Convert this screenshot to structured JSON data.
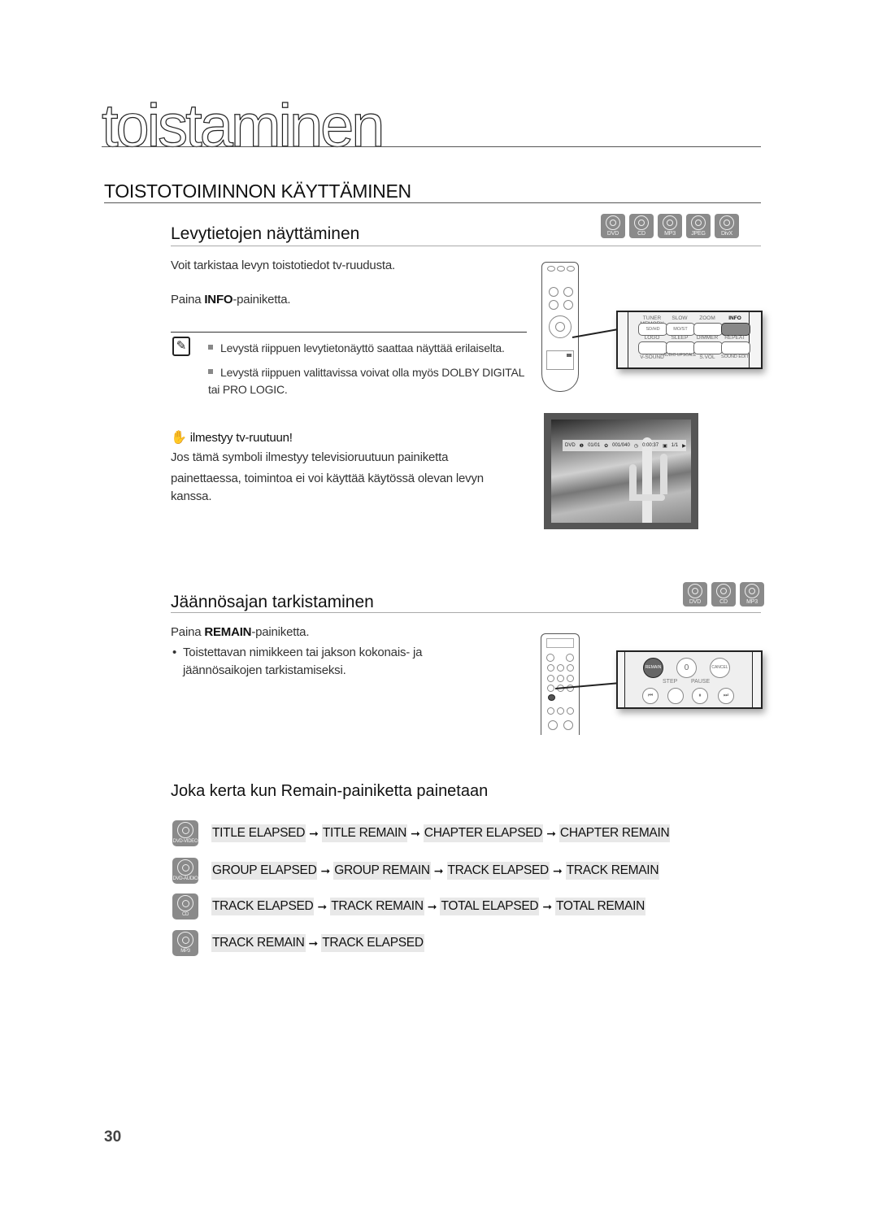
{
  "chapter_title": "toistaminen",
  "section_title": "TOISTOTOIMINNON KÄYTTÄMINEN",
  "disc_info": {
    "title": "Levytietojen näyttäminen",
    "disc_badges": [
      "DVD",
      "CD",
      "MP3",
      "JPEG",
      "DivX"
    ],
    "intro": "Voit tarkistaa levyn toistotiedot tv-ruudusta.",
    "press_prefix": "Paina ",
    "press_button": "INFO",
    "press_suffix": "-painiketta.",
    "notes": [
      "Levystä riippuen levytietonäyttö saattaa näyttää erilaiselta.",
      "Levystä riippuen valittavissa voivat olla myös DOLBY DIGITAL tai PRO LOGIC."
    ],
    "hand_heading": "ilmestyy tv-ruutuun!",
    "hand_text_1": "Jos tämä symboli ilmestyy televisioruutuun painiketta",
    "hand_text_2": "painettaessa, toimintoa ei voi käyttää käytössä olevan levyn kanssa.",
    "remote_callout": {
      "row1_labels": [
        "TUNER MEMORY",
        "SLOW",
        "ZOOM",
        "INFO"
      ],
      "row1_buttons": [
        "SD/HD",
        "MO/ST",
        "",
        ""
      ],
      "row2_labels": [
        "LOGO",
        "SLEEP",
        "DIMMER",
        "REPEAT"
      ],
      "row3_labels": [
        "V-SOUND",
        "AUDIO UPSCALE",
        "S.VOL",
        "SOUND EDIT"
      ]
    },
    "tv_osd": {
      "disc": "DVD",
      "title": "01/01",
      "chapter": "001/040",
      "time": "0:00:37",
      "angle": "1/1"
    }
  },
  "remain": {
    "title": "Jäännösajan tarkistaminen",
    "disc_badges": [
      "DVD",
      "CD",
      "MP3"
    ],
    "press_prefix": "Paina ",
    "press_button": "REMAIN",
    "press_suffix": "-painiketta.",
    "bullet": "Toistettavan nimikkeen tai jakson kokonais- ja jäännösaikojen tarkistamiseksi.",
    "remote_callout": {
      "row1": [
        "REMAIN",
        "0",
        "CANCEL"
      ],
      "row2_labels": [
        "STEP",
        "PAUSE"
      ],
      "row2_glyphs": [
        "⏮",
        "",
        "⏸",
        "⏭"
      ]
    }
  },
  "sequence": {
    "title": "Joka kerta kun Remain-painiketta painetaan",
    "arrow": "➞",
    "rows": [
      {
        "disc": "DVD-VIDEO",
        "steps": [
          "TITLE ELAPSED",
          "TITLE REMAIN",
          "CHAPTER ELAPSED",
          "CHAPTER REMAIN"
        ]
      },
      {
        "disc": "DVD-AUDIO",
        "steps": [
          "GROUP ELAPSED",
          "GROUP REMAIN",
          "TRACK ELAPSED",
          "TRACK REMAIN"
        ]
      },
      {
        "disc": "CD",
        "steps": [
          "TRACK ELAPSED",
          "TRACK REMAIN",
          "TOTAL ELAPSED",
          "TOTAL REMAIN"
        ]
      },
      {
        "disc": "MP3",
        "steps": [
          "TRACK REMAIN",
          "TRACK ELAPSED"
        ]
      }
    ]
  },
  "page_number": "30"
}
